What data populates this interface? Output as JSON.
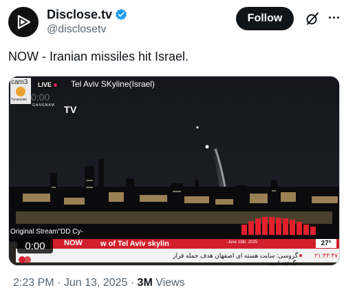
{
  "account": {
    "display_name": "Disclose.tv",
    "handle": "@disclosetv",
    "avatar_icon": "play-play-icon",
    "verified_icon": "verified-badge-icon",
    "verified_color": "#1d9bf0"
  },
  "actions": {
    "follow_label": "Follow",
    "grok_icon": "grok-icon",
    "more_icon": "more-dots-icon"
  },
  "tweet": {
    "text": "NOW - Iranian missiles hit Israel."
  },
  "media": {
    "cam_label": "cam3",
    "cam_sub": "Tyranoniki",
    "live_label": "LIVE",
    "stream_title": "Tel Aviv SKyline(Israel)",
    "faint_time": "0:00",
    "channel_name": "TV",
    "channel_small": "GANGNAM",
    "original_stream": "Original Stream\"DD Cy-",
    "ticker_now": "NOW",
    "ticker_headline": "w of Tel Aviv skylin",
    "ticker_date": "June 13th, 2025",
    "ticker_temp": "27°",
    "ticker_persian": "گروسی: سایت هسته ای اصفهان هدف حمله قرار نگرفته است",
    "ticker_number": "۲۱:۴۴:۴۷",
    "player_time": "0:00",
    "accent_red": "#d21f2c"
  },
  "meta": {
    "time": "2:23 PM",
    "sep1": "·",
    "date": "Jun 13, 2025",
    "sep2": "·",
    "views_count": "3M",
    "views_label": "Views"
  }
}
